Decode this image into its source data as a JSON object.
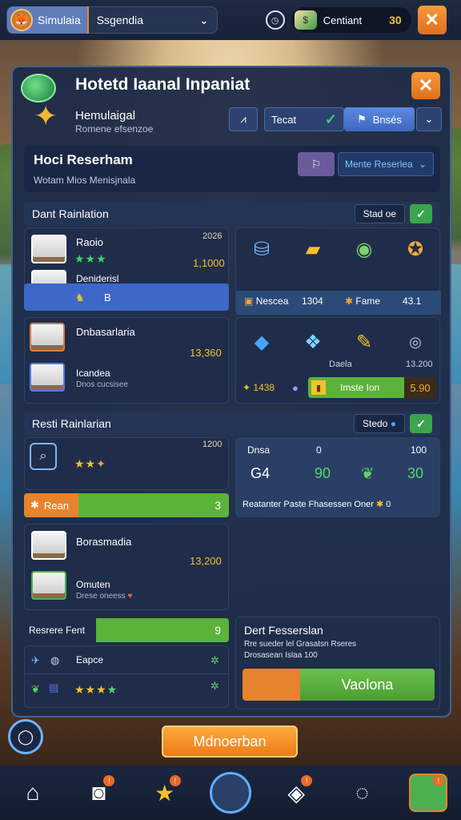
{
  "topbar": {
    "selector_chip": "Simulaia",
    "selector_value": "Ssgendia",
    "currency_label": "Centiant",
    "currency_amount": "30"
  },
  "panel": {
    "title": "Hotetd Iaanal Inpaniat",
    "subtitle1": "Hemulaigal",
    "subtitle2": "Romene efsenzoe",
    "tab_label": "Tecat",
    "button_label": "Bnsés"
  },
  "reservation": {
    "title": "Hoci Reserham",
    "subtitle": "Wotam Mios Menisjnala",
    "select_label": "Mente Reserlea"
  },
  "section1": {
    "header": "Dant Rainlation",
    "toggle": "Stad oe",
    "room1": {
      "name": "Raoio",
      "price": "1,1000",
      "code": "2026"
    },
    "room2": {
      "name": "Deniderisl"
    },
    "selected_row": {
      "label": "B"
    },
    "room3": {
      "name": "Dnbasarlaria",
      "price": "13,360"
    },
    "room4": {
      "name": "Icandea",
      "sub": "Dnos cucsisee"
    },
    "amen_row1": {
      "label": "Nescea",
      "value": "1304",
      "label2": "Fame",
      "value2": "43.1"
    },
    "amen_row2": {
      "label": "Daela",
      "value": "13.200",
      "value_a": "1438",
      "bar_label": "Imste Ion",
      "bar_value": "5.90"
    }
  },
  "section2": {
    "header": "Resti Rainlarian",
    "toggle": "Stedo",
    "item1": {
      "value": "1200"
    },
    "bar1": {
      "label": "Rean",
      "value": "3"
    },
    "room5": {
      "name": "Borasmadia",
      "price": "13,200"
    },
    "room6": {
      "name": "Omuten",
      "sub": "Drese oneess"
    },
    "stats": {
      "label": "Dnsa",
      "col1": "0",
      "col2": "100",
      "v1": "G4",
      "v2": "90",
      "v3": "30",
      "note": "Reatanter Paste Fhasessen Oner",
      "note_val": "0"
    },
    "bar2": {
      "label": "Resrere Fent",
      "value": "9"
    },
    "row_a": {
      "label": "Eapce"
    },
    "info": {
      "title": "Dert Fesserslan",
      "line1": "Rre sueder lel Grasatsn Rseres",
      "line2": "Drosasean Islaa 100"
    },
    "action_button": "Vaolona"
  },
  "bottom": {
    "button": "Mdnoerban"
  }
}
